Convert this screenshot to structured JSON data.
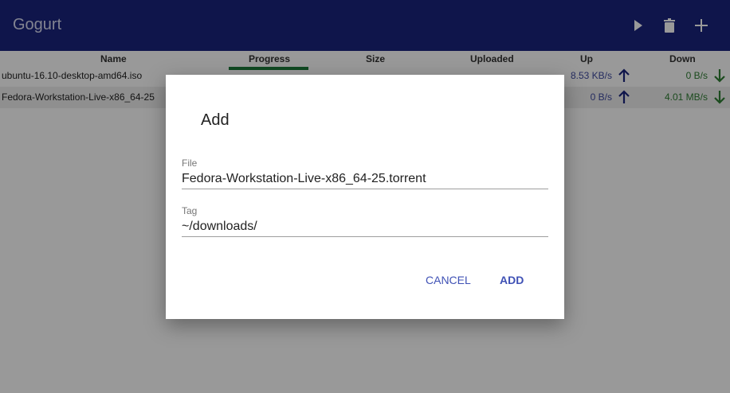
{
  "app": {
    "title": "Gogurt"
  },
  "toolbar": {
    "play_icon": "play-icon",
    "delete_icon": "trash-icon",
    "add_icon": "plus-icon"
  },
  "table": {
    "headers": {
      "name": "Name",
      "progress": "Progress",
      "size": "Size",
      "uploaded": "Uploaded",
      "up": "Up",
      "down": "Down"
    },
    "rows": [
      {
        "name": "ubuntu-16.10-desktop-amd64.iso",
        "progress": 1.0,
        "up": "8.53 KB/s",
        "down": "0 B/s"
      },
      {
        "name": "Fedora-Workstation-Live-x86_64-25",
        "up": "0 B/s",
        "down": "4.01 MB/s"
      }
    ]
  },
  "dialog": {
    "title": "Add",
    "file_label": "File",
    "file_value": "Fedora-Workstation-Live-x86_64-25.torrent",
    "tag_label": "Tag",
    "tag_value": "~/downloads/",
    "cancel_label": "CANCEL",
    "add_label": "ADD"
  },
  "colors": {
    "appbar": "#1a237e",
    "accent": "#3f51b5",
    "up": "#3f4aa0",
    "down": "#2e7d32"
  }
}
